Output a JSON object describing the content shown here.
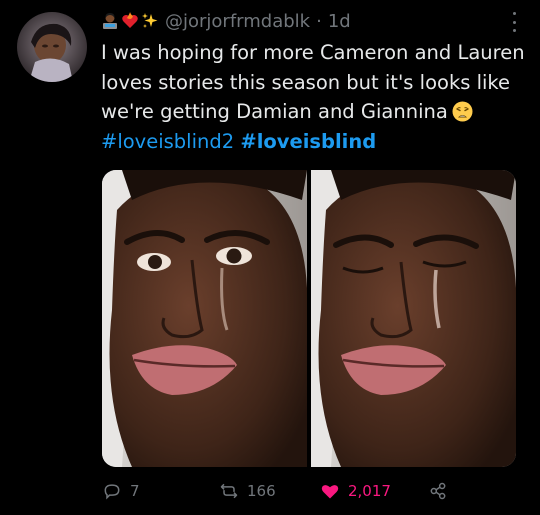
{
  "tweet": {
    "handle": "@jorjorfrmdablk",
    "separator": "·",
    "time": "1d",
    "text_main": "I was hoping for more Cameron and Lauren loves stories this season but it's looks like we're getting Damian and Giannina",
    "hashtags": [
      "#loveisblind2",
      "#loveisblind"
    ],
    "header_emojis": [
      "woman-technologist-emoji",
      "fire-heart-emoji",
      "sparkles-emoji"
    ],
    "text_emoji": "weary-face-emoji"
  },
  "actions": {
    "replies": "7",
    "retweets": "166",
    "likes": "2,017"
  },
  "colors": {
    "background": "#000000",
    "text": "#e7e9ea",
    "secondary": "#71767b",
    "link": "#1d9bf0",
    "like": "#f91880"
  }
}
